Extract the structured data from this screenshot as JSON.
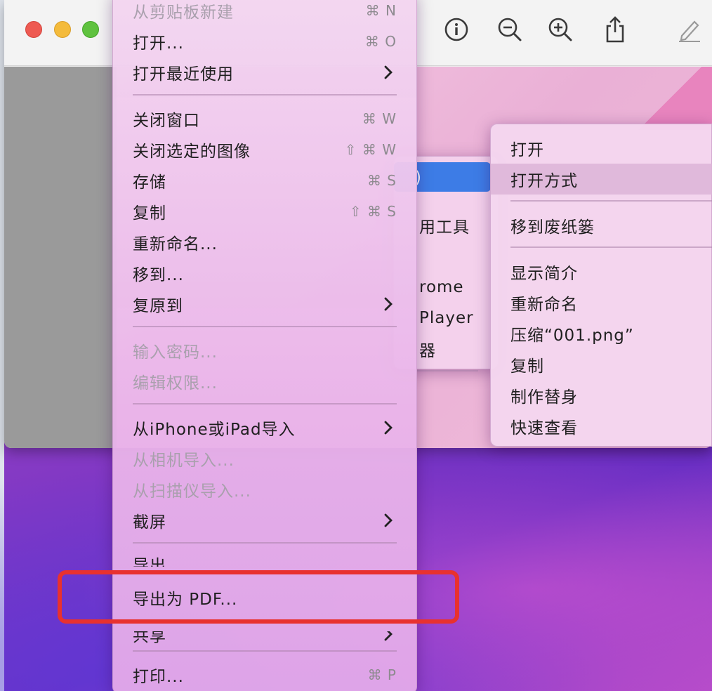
{
  "window": {
    "toolbar": {
      "info_icon": "info-icon",
      "zoom_out_icon": "zoom-out-icon",
      "zoom_in_icon": "zoom-in-icon",
      "share_icon": "share-icon",
      "markup_icon": "markup-pen-icon"
    },
    "traffic_colors": {
      "close": "#ee5a52",
      "minimize": "#f4bb3c",
      "zoom": "#5fc23f"
    }
  },
  "file_menu": {
    "items": [
      {
        "label": "从剪贴板新建",
        "shortcut": "⌘ N",
        "disabled": true
      },
      {
        "label": "打开...",
        "shortcut": "⌘ O"
      },
      {
        "label": "打开最近使用",
        "submenu": true
      },
      {
        "label": "关闭窗口",
        "shortcut": "⌘ W"
      },
      {
        "label": "关闭选定的图像",
        "shortcut": "⇧ ⌘ W"
      },
      {
        "label": "存储",
        "shortcut": "⌘ S"
      },
      {
        "label": "复制",
        "shortcut": "⇧ ⌘ S"
      },
      {
        "label": "重新命名..."
      },
      {
        "label": "移到..."
      },
      {
        "label": "复原到",
        "submenu": true
      },
      {
        "label": "输入密码...",
        "disabled": true
      },
      {
        "label": "编辑权限...",
        "disabled": true
      },
      {
        "label": "从iPhone或iPad导入",
        "submenu": true
      },
      {
        "label": "从相机导入...",
        "disabled": true
      },
      {
        "label": "从扫描仪导入...",
        "disabled": true
      },
      {
        "label": "截屏",
        "submenu": true
      },
      {
        "label": "导出..."
      },
      {
        "label": "导出为 PDF..."
      },
      {
        "label": "共享",
        "submenu": true
      },
      {
        "label": "打印...",
        "shortcut": "⌘ P"
      }
    ]
  },
  "open_with_menu": {
    "items": [
      {
        "label": ")"
      },
      {
        "label": "用工具"
      },
      {
        "label": "rome"
      },
      {
        "label": "Player"
      },
      {
        "label": "器"
      }
    ]
  },
  "context_menu": {
    "items": [
      {
        "label": "打开"
      },
      {
        "label": "打开方式"
      },
      {
        "label": "移到废纸篓"
      },
      {
        "label": "显示简介"
      },
      {
        "label": "重新命名"
      },
      {
        "label": "压缩“001.png”"
      },
      {
        "label": "复制"
      },
      {
        "label": "制作替身"
      },
      {
        "label": "快速查看"
      }
    ]
  },
  "annotation": {
    "color": "#e8312f",
    "target": "导出为 PDF..."
  }
}
